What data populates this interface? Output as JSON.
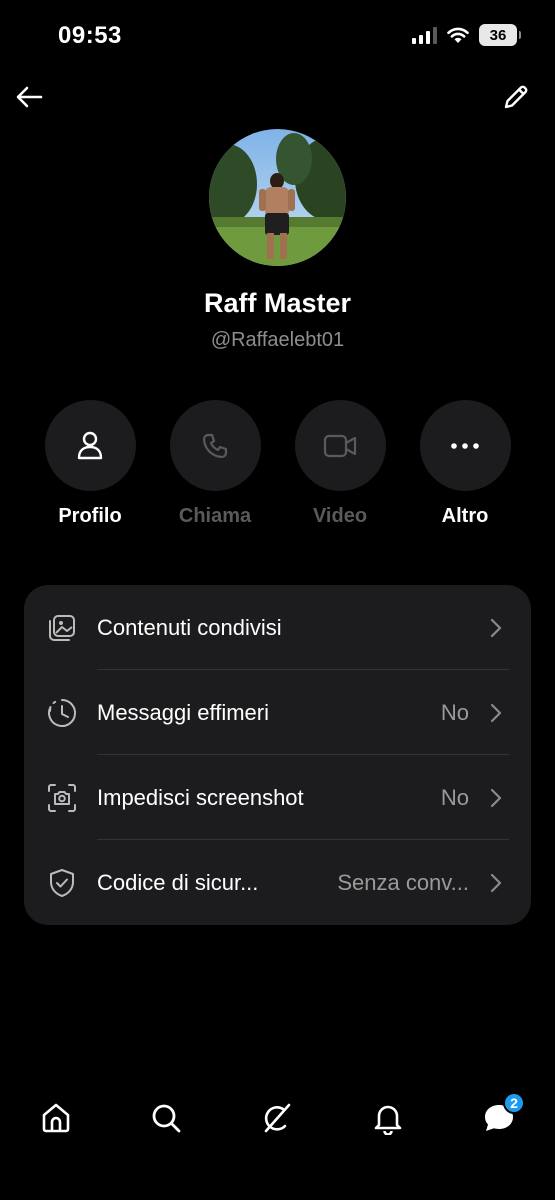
{
  "status_bar": {
    "time": "09:53",
    "battery": "36"
  },
  "nav": {
    "back_icon": "arrow-left-icon",
    "edit_icon": "pencil-icon"
  },
  "profile": {
    "name": "Raff Master",
    "handle": "@Raffaelebt01"
  },
  "actions": [
    {
      "label": "Profilo",
      "icon": "person-icon",
      "enabled": true
    },
    {
      "label": "Chiama",
      "icon": "phone-icon",
      "enabled": false
    },
    {
      "label": "Video",
      "icon": "video-icon",
      "enabled": false
    },
    {
      "label": "Altro",
      "icon": "more-icon",
      "enabled": true
    }
  ],
  "settings": [
    {
      "label": "Contenuti condivisi",
      "value": "",
      "icon": "media-icon"
    },
    {
      "label": "Messaggi effimeri",
      "value": "No",
      "icon": "timer-icon"
    },
    {
      "label": "Impedisci screenshot",
      "value": "No",
      "icon": "screenshot-icon"
    },
    {
      "label": "Codice di sicur...",
      "value": "Senza conv...",
      "icon": "shield-icon"
    }
  ],
  "bottom_nav": {
    "items": [
      "home-icon",
      "search-icon",
      "grok-icon",
      "bell-icon",
      "messages-icon"
    ],
    "messages_badge": "2"
  },
  "colors": {
    "background": "#000000",
    "card": "#1c1c1e",
    "badge": "#1d9bf0",
    "muted": "#8e8e8e"
  }
}
